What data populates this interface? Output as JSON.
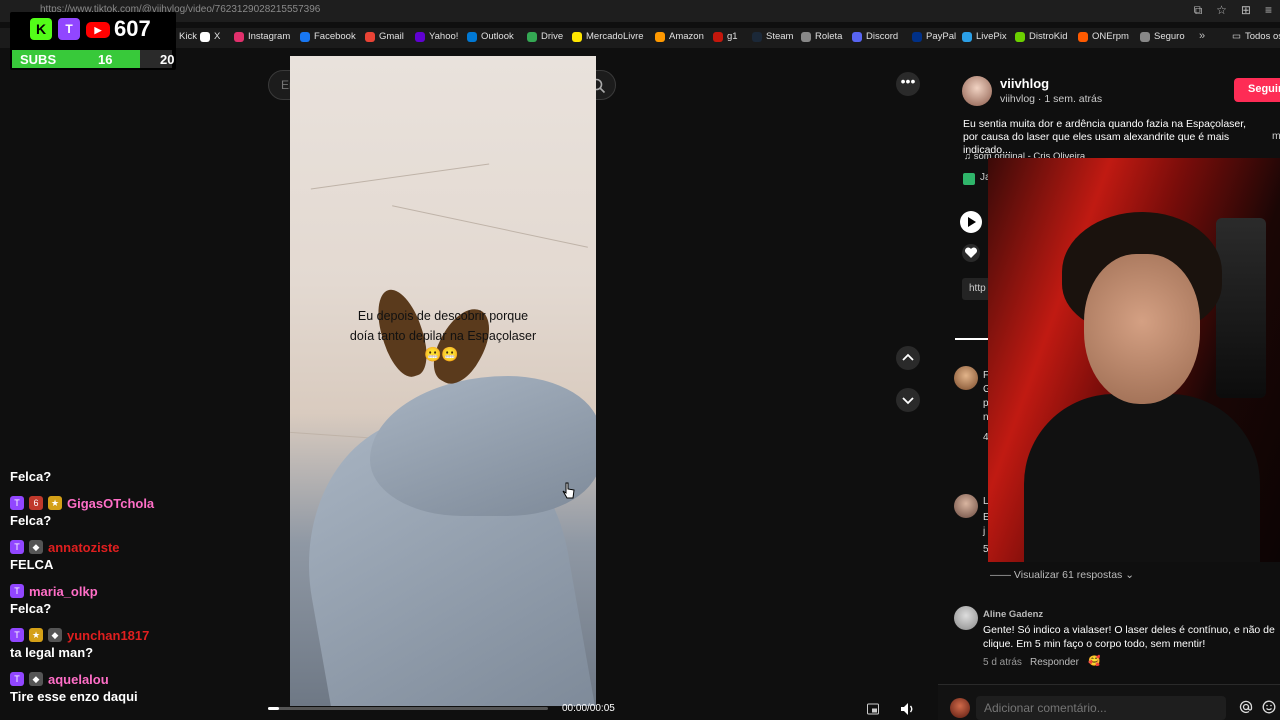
{
  "browser": {
    "url": "https://www.tiktok.com/@viihvlog/video/7623129028215557396"
  },
  "bookmarks": [
    {
      "label": "Kick",
      "color": "#53fc18",
      "icon": "kick-icon"
    },
    {
      "label": "X",
      "color": "#ffffff",
      "icon": "x-icon"
    },
    {
      "label": "Instagram",
      "color": "#e1306c",
      "icon": "instagram-icon"
    },
    {
      "label": "Facebook",
      "color": "#1877f2",
      "icon": "facebook-icon"
    },
    {
      "label": "Gmail",
      "color": "#ea4335",
      "icon": "gmail-icon"
    },
    {
      "label": "Yahoo!",
      "color": "#6001d2",
      "icon": "yahoo-icon"
    },
    {
      "label": "Outlook",
      "color": "#0078d4",
      "icon": "outlook-icon"
    },
    {
      "label": "Drive",
      "color": "#34a853",
      "icon": "drive-icon"
    },
    {
      "label": "MercadoLivre",
      "color": "#ffe600",
      "icon": "mercadolivre-icon"
    },
    {
      "label": "Amazon",
      "color": "#ff9900",
      "icon": "amazon-icon"
    },
    {
      "label": "g1",
      "color": "#c4170c",
      "icon": "g1-icon"
    },
    {
      "label": "Steam",
      "color": "#1b2838",
      "icon": "steam-icon"
    },
    {
      "label": "Roleta",
      "color": "#888888",
      "icon": "roleta-icon"
    },
    {
      "label": "Discord",
      "color": "#5865f2",
      "icon": "discord-icon"
    },
    {
      "label": "PayPal",
      "color": "#003087",
      "icon": "paypal-icon"
    },
    {
      "label": "LivePix",
      "color": "#2b9fe6",
      "icon": "livepix-icon"
    },
    {
      "label": "DistroKid",
      "color": "#6bd000",
      "icon": "distrokid-icon"
    },
    {
      "label": "ONErpm",
      "color": "#ff5a00",
      "icon": "onerpm-icon"
    },
    {
      "label": "Seguro",
      "color": "#888888",
      "icon": "seguro-icon"
    }
  ],
  "bookmarks_more": "»",
  "bookmarks_folder": "Todos os favoritos",
  "overlay": {
    "viewer_count": "607",
    "subs_label": "SUBS",
    "subs_current": "16",
    "subs_goal": "20",
    "subs_progress": 0.8,
    "kick_glyph": "K",
    "twitch_glyph": "T",
    "yt_glyph": "▶"
  },
  "search": {
    "placeholder": "Encontrar conteúdo relacionado"
  },
  "video": {
    "caption_line1": "Eu depois de descobrir porque",
    "caption_line2": "doía tanto depilar na Espaçolaser",
    "emoji": "😬😬",
    "time": "00:00/00:05",
    "progress": 0.04
  },
  "more_label": "•••",
  "chat": [
    {
      "user": "",
      "color": "#ffffff",
      "text": "Felca?",
      "badges": []
    },
    {
      "user": "GigasOTchola",
      "color": "#ff6ec7",
      "text": "Felca?",
      "badges": [
        "twitch",
        "sub",
        "gift"
      ]
    },
    {
      "user": "annatoziste",
      "color": "#e01f1f",
      "text": "FELCA",
      "badges": [
        "twitch",
        "gray"
      ]
    },
    {
      "user": "maria_olkp",
      "color": "#ff6ec7",
      "text": "Felca?",
      "badges": [
        "twitch"
      ]
    },
    {
      "user": "yunchan1817",
      "color": "#e01f1f",
      "text": "ta legal man?",
      "badges": [
        "twitch",
        "gift",
        "gray"
      ]
    },
    {
      "user": "aquelalou",
      "color": "#ff6ec7",
      "text": "Tire esse enzo daqui",
      "badges": [
        "twitch",
        "gray"
      ]
    }
  ],
  "post": {
    "author": "viivhlog",
    "meta": "viihvlog · 1 sem. atrás",
    "follow_label": "Seguir",
    "description": "Eu sentia muita dor e ardência quando fazia na Espaçolaser, por causa do laser que eles usam alexandrite que é mais indicado...",
    "more_label": "m",
    "sound": "♫  som original - Cris Oliveira",
    "tag_text": "Ja",
    "link_label": "http"
  },
  "comments": {
    "frag1": "F",
    "frag2": "G",
    "frag3": "p",
    "frag4": "n",
    "frag5": "4",
    "frag6": "L",
    "frag7": "E",
    "frag8": "j",
    "frag9": "5",
    "view_replies": "——  Visualizar 61 respostas  ⌄",
    "user": "Aline Gadenz",
    "text": "Gente! Só indico a vialaser! O laser deles é contínuo, e não de clique. Em 5 min faço o corpo todo, sem mentir!",
    "time": "5 d atrás",
    "reply_label": "Responder",
    "emoji": "🥰"
  },
  "comment_input": {
    "placeholder": "Adicionar comentário..."
  }
}
